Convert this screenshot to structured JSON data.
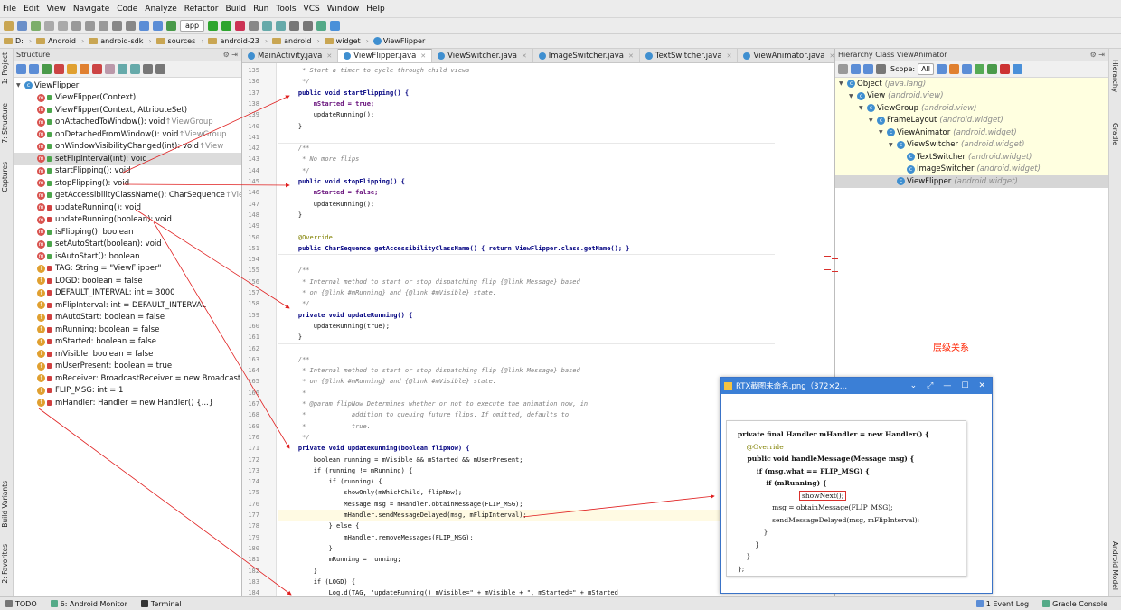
{
  "menu": [
    "File",
    "Edit",
    "View",
    "Navigate",
    "Code",
    "Analyze",
    "Refactor",
    "Build",
    "Run",
    "Tools",
    "VCS",
    "Window",
    "Help"
  ],
  "toolbar": {
    "run_config": "app"
  },
  "breadcrumb": [
    "D:",
    "Android",
    "android-sdk",
    "sources",
    "android-23",
    "android",
    "widget",
    "ViewFlipper"
  ],
  "left_strip": {
    "project": "1: Project",
    "structure": "7: Structure",
    "captures": "Captures",
    "build_variants": "Build Variants",
    "favorites": "2: Favorites"
  },
  "right_strip": {
    "hierarchy": "Hierarchy",
    "gradle": "Gradle",
    "android_model": "Android Model"
  },
  "structure": {
    "title": "Structure",
    "root": "ViewFlipper",
    "items": [
      {
        "kind": "m",
        "access": "pub",
        "text": "ViewFlipper(Context)",
        "extra": ""
      },
      {
        "kind": "m",
        "access": "pub",
        "text": "ViewFlipper(Context, AttributeSet)",
        "extra": ""
      },
      {
        "kind": "m",
        "access": "pub",
        "text": "onAttachedToWindow(): void ",
        "extra": "↑ViewGroup"
      },
      {
        "kind": "m",
        "access": "pub",
        "text": "onDetachedFromWindow(): void ",
        "extra": "↑ViewGroup"
      },
      {
        "kind": "m",
        "access": "pub",
        "text": "onWindowVisibilityChanged(int): void ",
        "extra": "↑View"
      },
      {
        "kind": "m",
        "access": "pub",
        "text": "setFlipInterval(int): void",
        "extra": ""
      },
      {
        "kind": "m",
        "access": "pub",
        "text": "startFlipping(): void",
        "extra": ""
      },
      {
        "kind": "m",
        "access": "pub",
        "text": "stopFlipping(): void",
        "extra": ""
      },
      {
        "kind": "m",
        "access": "pub",
        "text": "getAccessibilityClassName(): CharSequence ",
        "extra": "↑ViewAnim"
      },
      {
        "kind": "m",
        "access": "priv",
        "text": "updateRunning(): void",
        "extra": ""
      },
      {
        "kind": "m",
        "access": "priv",
        "text": "updateRunning(boolean): void",
        "extra": ""
      },
      {
        "kind": "m",
        "access": "pub",
        "text": "isFlipping(): boolean",
        "extra": ""
      },
      {
        "kind": "m",
        "access": "pub",
        "text": "setAutoStart(boolean): void",
        "extra": ""
      },
      {
        "kind": "m",
        "access": "pub",
        "text": "isAutoStart(): boolean",
        "extra": ""
      },
      {
        "kind": "f",
        "access": "priv",
        "text": "TAG: String = \"ViewFlipper\"",
        "extra": ""
      },
      {
        "kind": "f",
        "access": "priv",
        "text": "LOGD: boolean = false",
        "extra": ""
      },
      {
        "kind": "f",
        "access": "priv",
        "text": "DEFAULT_INTERVAL: int = 3000",
        "extra": ""
      },
      {
        "kind": "f",
        "access": "priv",
        "text": "mFlipInterval: int = DEFAULT_INTERVAL",
        "extra": ""
      },
      {
        "kind": "f",
        "access": "priv",
        "text": "mAutoStart: boolean = false",
        "extra": ""
      },
      {
        "kind": "f",
        "access": "priv",
        "text": "mRunning: boolean = false",
        "extra": ""
      },
      {
        "kind": "f",
        "access": "priv",
        "text": "mStarted: boolean = false",
        "extra": ""
      },
      {
        "kind": "f",
        "access": "priv",
        "text": "mVisible: boolean = false",
        "extra": ""
      },
      {
        "kind": "f",
        "access": "priv",
        "text": "mUserPresent: boolean = true",
        "extra": ""
      },
      {
        "kind": "f",
        "access": "priv",
        "text": "mReceiver: BroadcastReceiver = new BroadcastReceiv",
        "extra": ""
      },
      {
        "kind": "f",
        "access": "priv",
        "text": "FLIP_MSG: int = 1",
        "extra": ""
      },
      {
        "kind": "f",
        "access": "priv",
        "text": "mHandler: Handler = new Handler() {...}",
        "extra": ""
      }
    ]
  },
  "tabs": [
    "MainActivity.java",
    "ViewFlipper.java",
    "ViewSwitcher.java",
    "ImageSwitcher.java",
    "TextSwitcher.java",
    "ViewAnimator.java"
  ],
  "code_lines": [
    {
      "n": "135",
      "t": "     * Start a timer to cycle through child views",
      "c": "cm"
    },
    {
      "n": "136",
      "t": "     */",
      "c": "cm"
    },
    {
      "n": "137",
      "t": "    public void startFlipping() {",
      "c": "kw"
    },
    {
      "n": "138",
      "t": "        mStarted = true;",
      "c": "fd"
    },
    {
      "n": "139",
      "t": "        updateRunning();",
      "c": ""
    },
    {
      "n": "140",
      "t": "    }",
      "c": ""
    },
    {
      "n": "141",
      "t": "",
      "c": ""
    },
    {
      "n": "142",
      "t": "    /**",
      "c": "cm"
    },
    {
      "n": "143",
      "t": "     * No more flips",
      "c": "cm"
    },
    {
      "n": "144",
      "t": "     */",
      "c": "cm"
    },
    {
      "n": "145",
      "t": "    public void stopFlipping() {",
      "c": "kw"
    },
    {
      "n": "146",
      "t": "        mStarted = false;",
      "c": "fd"
    },
    {
      "n": "147",
      "t": "        updateRunning();",
      "c": ""
    },
    {
      "n": "148",
      "t": "    }",
      "c": ""
    },
    {
      "n": "149",
      "t": "",
      "c": ""
    },
    {
      "n": "150",
      "t": "    @Override",
      "c": "ann"
    },
    {
      "n": "151",
      "t": "    public CharSequence getAccessibilityClassName() { return ViewFlipper.class.getName(); }",
      "c": "kw"
    },
    {
      "n": "154",
      "t": "",
      "c": ""
    },
    {
      "n": "155",
      "t": "    /**",
      "c": "cm"
    },
    {
      "n": "156",
      "t": "     * Internal method to start or stop dispatching flip {@link Message} based",
      "c": "cm"
    },
    {
      "n": "157",
      "t": "     * on {@link #mRunning} and {@link #mVisible} state.",
      "c": "cm"
    },
    {
      "n": "158",
      "t": "     */",
      "c": "cm"
    },
    {
      "n": "159",
      "t": "    private void updateRunning() {",
      "c": "kw"
    },
    {
      "n": "160",
      "t": "        updateRunning(true);",
      "c": ""
    },
    {
      "n": "161",
      "t": "    }",
      "c": ""
    },
    {
      "n": "162",
      "t": "",
      "c": ""
    },
    {
      "n": "163",
      "t": "    /**",
      "c": "cm"
    },
    {
      "n": "164",
      "t": "     * Internal method to start or stop dispatching flip {@link Message} based",
      "c": "cm"
    },
    {
      "n": "165",
      "t": "     * on {@link #mRunning} and {@link #mVisible} state.",
      "c": "cm"
    },
    {
      "n": "166",
      "t": "     *",
      "c": "cm"
    },
    {
      "n": "167",
      "t": "     * @param flipNow Determines whether or not to execute the animation now, in",
      "c": "cm"
    },
    {
      "n": "168",
      "t": "     *            addition to queuing future flips. If omitted, defaults to",
      "c": "cm"
    },
    {
      "n": "169",
      "t": "     *            true.",
      "c": "cm"
    },
    {
      "n": "170",
      "t": "     */",
      "c": "cm"
    },
    {
      "n": "171",
      "t": "    private void updateRunning(boolean flipNow) {",
      "c": "kw"
    },
    {
      "n": "172",
      "t": "        boolean running = mVisible && mStarted && mUserPresent;",
      "c": ""
    },
    {
      "n": "173",
      "t": "        if (running != mRunning) {",
      "c": ""
    },
    {
      "n": "174",
      "t": "            if (running) {",
      "c": ""
    },
    {
      "n": "175",
      "t": "                showOnly(mWhichChild, flipNow);",
      "c": ""
    },
    {
      "n": "176",
      "t": "                Message msg = mHandler.obtainMessage(FLIP_MSG);",
      "c": ""
    },
    {
      "n": "177",
      "t": "                mHandler.sendMessageDelayed(msg, mFlipInterval);",
      "c": ""
    },
    {
      "n": "178",
      "t": "            } else {",
      "c": ""
    },
    {
      "n": "179",
      "t": "                mHandler.removeMessages(FLIP_MSG);",
      "c": ""
    },
    {
      "n": "180",
      "t": "            }",
      "c": ""
    },
    {
      "n": "181",
      "t": "            mRunning = running;",
      "c": ""
    },
    {
      "n": "182",
      "t": "        }",
      "c": ""
    },
    {
      "n": "183",
      "t": "        if (LOGD) {",
      "c": ""
    },
    {
      "n": "184",
      "t": "            Log.d(TAG, \"updateRunning() mVisible=\" + mVisible + \", mStarted=\" + mStarted",
      "c": ""
    }
  ],
  "hierarchy": {
    "title": "Hierarchy Class ViewAnimator",
    "scope_label": "Scope:",
    "scope_value": "All",
    "rows": [
      {
        "name": "Object",
        "pkg": "(java.lang)"
      },
      {
        "name": "View",
        "pkg": "(android.view)"
      },
      {
        "name": "ViewGroup",
        "pkg": "(android.view)"
      },
      {
        "name": "FrameLayout",
        "pkg": "(android.widget)"
      },
      {
        "name": "ViewAnimator",
        "pkg": "(android.widget)"
      },
      {
        "name": "ViewSwitcher",
        "pkg": "(android.widget)"
      },
      {
        "name": "TextSwitcher",
        "pkg": "(android.widget)"
      },
      {
        "name": "ImageSwitcher",
        "pkg": "(android.widget)"
      },
      {
        "name": "ViewFlipper",
        "pkg": "(android.widget)"
      }
    ]
  },
  "annotation_note": "层级关系",
  "popup": {
    "title": "RTX截图未命名.png（372×2...",
    "lines": [
      "private final Handler mHandler = new Handler() {",
      "    @Override",
      "    public void handleMessage(Message msg) {",
      "        if (msg.what == FLIP_MSG) {",
      "            if (mRunning) {",
      "                showNext();",
      "                msg = obtainMessage(FLIP_MSG);",
      "                sendMessageDelayed(msg, mFlipInterval);",
      "            }",
      "        }",
      "    }",
      "};"
    ]
  },
  "status": [
    "TODO",
    "6: Android Monitor",
    "Terminal",
    "1 Event Log",
    "Gradle Console"
  ],
  "colors": {
    "accent": "#3b7fd6",
    "annotation": "#ff2200",
    "keyword": "#000080",
    "field": "#660e7a"
  }
}
